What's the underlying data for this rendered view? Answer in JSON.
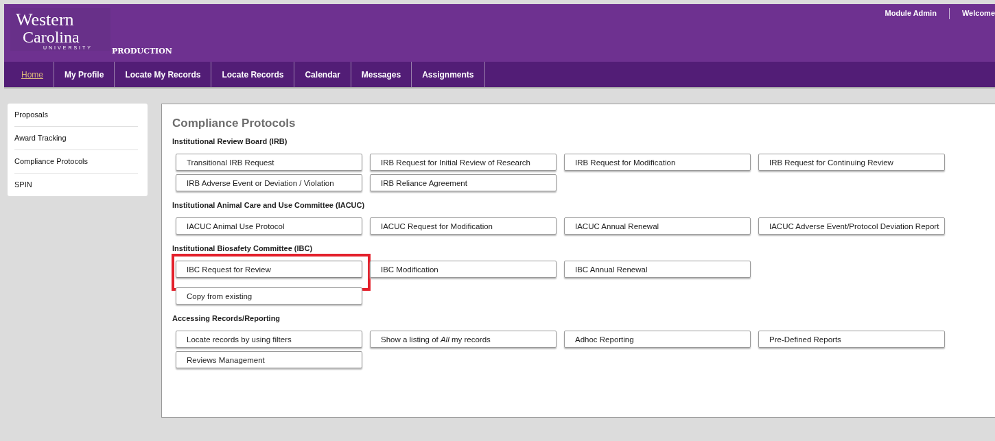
{
  "header": {
    "logo": {
      "line1": "Western",
      "line2": "Carolina",
      "line3": "UNIVERSITY"
    },
    "environment": "PRODUCTION",
    "user_links": [
      "Module Admin",
      "Welcome"
    ]
  },
  "nav": [
    {
      "label": "Home",
      "selected": true
    },
    {
      "label": "My Profile",
      "selected": false
    },
    {
      "label": "Locate My Records",
      "selected": false
    },
    {
      "label": "Locate Records",
      "selected": false
    },
    {
      "label": "Calendar",
      "selected": false
    },
    {
      "label": "Messages",
      "selected": false
    },
    {
      "label": "Assignments",
      "selected": false
    }
  ],
  "sidebar": {
    "items": [
      "Proposals",
      "Award Tracking",
      "Compliance Protocols",
      "SPIN"
    ]
  },
  "main": {
    "title": "Compliance Protocols",
    "groups": [
      {
        "heading": "Institutional Review Board (IRB)",
        "buttons": [
          {
            "label": "Transitional IRB Request",
            "highlighted": false
          },
          {
            "label": "IRB Request for Initial Review of Research",
            "highlighted": false
          },
          {
            "label": "IRB Request for Modification",
            "highlighted": false
          },
          {
            "label": "IRB Request for Continuing Review",
            "highlighted": false
          },
          {
            "label": "IRB Adverse Event or Deviation / Violation",
            "highlighted": false
          },
          {
            "label": "IRB Reliance Agreement",
            "highlighted": false
          }
        ]
      },
      {
        "heading": "Institutional Animal Care and Use Committee (IACUC)",
        "buttons": [
          {
            "label": "IACUC Animal Use Protocol",
            "highlighted": false
          },
          {
            "label": "IACUC Request for Modification",
            "highlighted": false
          },
          {
            "label": "IACUC Annual Renewal",
            "highlighted": false
          },
          {
            "label": "IACUC Adverse Event/Protocol Deviation Report",
            "highlighted": false
          }
        ]
      },
      {
        "heading": "Institutional Biosafety Committee (IBC)",
        "buttons": [
          {
            "label": "IBC Request for Review",
            "highlighted": true
          },
          {
            "label": "IBC Modification",
            "highlighted": false
          },
          {
            "label": "IBC Annual Renewal",
            "highlighted": false
          }
        ]
      },
      {
        "buttons": [
          {
            "label": "Copy from existing",
            "highlighted": false
          }
        ]
      },
      {
        "heading": "Accessing Records/Reporting",
        "buttons": [
          {
            "label": "Locate records by using filters",
            "highlighted": false
          },
          {
            "label": "Show a listing of *All* my records",
            "highlighted": false
          },
          {
            "label": "Adhoc Reporting",
            "highlighted": false
          },
          {
            "label": "Pre-Defined Reports",
            "highlighted": false
          },
          {
            "label": "Reviews Management",
            "highlighted": false
          }
        ]
      }
    ]
  }
}
